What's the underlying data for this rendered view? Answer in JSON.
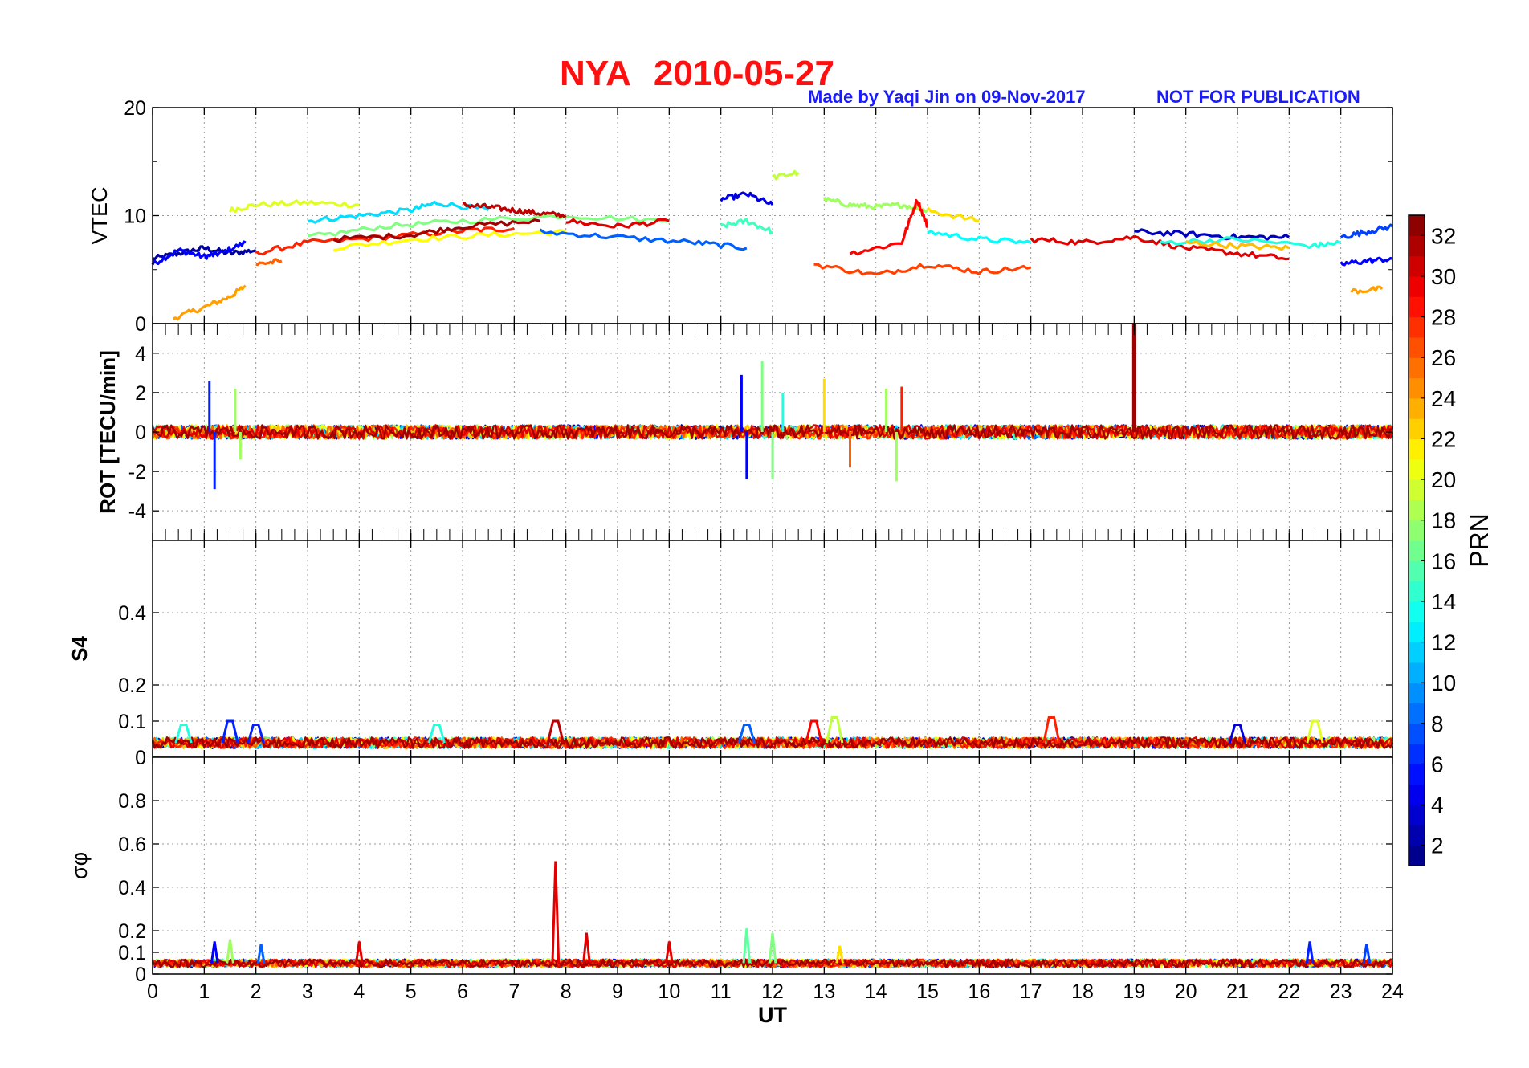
{
  "header": {
    "station": "NYA",
    "date": "2010-05-27",
    "credit": "Made by Yaqi Jin on 09-Nov-2017",
    "notice": "NOT FOR PUBLICATION"
  },
  "colors": {
    "title": "#ff1010",
    "credit": "#1a1aff",
    "grid": "#9a9a9a",
    "axis": "#000000"
  },
  "chart_data": [
    {
      "type": "line",
      "panel": "vtec",
      "ylabel": "VTEC",
      "ylim": [
        0,
        20
      ],
      "yticks": [
        0,
        10,
        20
      ],
      "xlim": [
        0,
        24
      ],
      "grid": true,
      "series": [
        {
          "prn": 2,
          "x": [
            0.0,
            0.5,
            1.0,
            1.5,
            2.0
          ],
          "y": [
            6.0,
            6.5,
            7.0,
            6.5,
            6.8
          ]
        },
        {
          "prn": 5,
          "x": [
            0.0,
            0.5,
            1.0,
            1.3,
            1.8
          ],
          "y": [
            5.5,
            6.8,
            6.2,
            6.5,
            7.5
          ]
        },
        {
          "prn": 24,
          "x": [
            0.4,
            1.0,
            1.5,
            1.8
          ],
          "y": [
            0.5,
            1.5,
            2.5,
            3.5
          ]
        },
        {
          "prn": 20,
          "x": [
            1.5,
            2.0,
            3.0,
            4.0
          ],
          "y": [
            10.5,
            11.0,
            11.2,
            11.0
          ]
        },
        {
          "prn": 26,
          "x": [
            2.0,
            2.5
          ],
          "y": [
            5.5,
            5.8
          ]
        },
        {
          "prn": 28,
          "x": [
            2.0,
            3.0,
            4.5,
            6.0,
            7.0
          ],
          "y": [
            6.5,
            7.5,
            8.0,
            8.6,
            8.8
          ]
        },
        {
          "prn": 12,
          "x": [
            3.0,
            4.0,
            5.0,
            5.5,
            6.5
          ],
          "y": [
            9.5,
            10.0,
            10.5,
            11.2,
            10.5
          ]
        },
        {
          "prn": 17,
          "x": [
            3.0,
            4.5,
            6.0,
            8.0,
            10.0
          ],
          "y": [
            8.0,
            9.0,
            9.5,
            10.0,
            9.5
          ]
        },
        {
          "prn": 21,
          "x": [
            3.5,
            5.0,
            6.5,
            8.0
          ],
          "y": [
            7.0,
            7.8,
            8.2,
            8.5
          ]
        },
        {
          "prn": 31,
          "x": [
            6.0,
            6.5,
            7.0,
            7.5,
            8.0
          ],
          "y": [
            11.0,
            10.8,
            10.5,
            10.2,
            10.0
          ]
        },
        {
          "prn": 32,
          "x": [
            3.5,
            5.0,
            6.0,
            7.5
          ],
          "y": [
            7.8,
            8.2,
            9.0,
            9.5
          ]
        },
        {
          "prn": 8,
          "x": [
            7.5,
            9.0,
            10.5,
            11.5
          ],
          "y": [
            8.5,
            8.0,
            7.5,
            7.0
          ]
        },
        {
          "prn": 30,
          "x": [
            8.0,
            9.0,
            10.0
          ],
          "y": [
            9.5,
            9.0,
            9.5
          ]
        },
        {
          "prn": 4,
          "x": [
            11.0,
            11.5,
            12.0
          ],
          "y": [
            11.5,
            12.0,
            11.0
          ]
        },
        {
          "prn": 15,
          "x": [
            11.0,
            11.5,
            12.0
          ],
          "y": [
            9.0,
            9.5,
            8.5
          ]
        },
        {
          "prn": 19,
          "x": [
            12.0,
            12.5
          ],
          "y": [
            13.5,
            14.0
          ]
        },
        {
          "prn": 18,
          "x": [
            13.0,
            13.5,
            14.0,
            14.5,
            15.0
          ],
          "y": [
            11.5,
            11.0,
            10.8,
            11.0,
            10.5
          ]
        },
        {
          "prn": 29,
          "x": [
            13.5,
            14.5,
            14.8,
            15.0
          ],
          "y": [
            6.5,
            7.5,
            11.5,
            9.0
          ]
        },
        {
          "prn": 27,
          "x": [
            12.8,
            14.0,
            15.0,
            16.0,
            17.0
          ],
          "y": [
            5.5,
            4.5,
            5.5,
            4.8,
            5.2
          ]
        },
        {
          "prn": 22,
          "x": [
            15.0,
            16.0
          ],
          "y": [
            10.5,
            9.5
          ]
        },
        {
          "prn": 13,
          "x": [
            15.0,
            16.0,
            17.0
          ],
          "y": [
            8.5,
            7.8,
            7.5
          ]
        },
        {
          "prn": 30,
          "x": [
            17.0,
            18.0,
            19.0,
            20.0,
            21.0,
            22.0
          ],
          "y": [
            7.8,
            7.5,
            8.0,
            7.0,
            6.5,
            6.0
          ]
        },
        {
          "prn": 3,
          "x": [
            19.0,
            20.0,
            21.0,
            22.0
          ],
          "y": [
            8.5,
            8.3,
            8.0,
            8.0
          ]
        },
        {
          "prn": 14,
          "x": [
            19.5,
            21.0,
            22.5,
            23.0
          ],
          "y": [
            7.5,
            7.8,
            7.2,
            7.5
          ]
        },
        {
          "prn": 23,
          "x": [
            20.0,
            21.0,
            22.0
          ],
          "y": [
            7.5,
            7.2,
            7.0
          ]
        },
        {
          "prn": 7,
          "x": [
            23.0,
            23.5,
            24.0
          ],
          "y": [
            8.0,
            8.5,
            9.0
          ]
        },
        {
          "prn": 24,
          "x": [
            23.2,
            23.8
          ],
          "y": [
            3.0,
            3.2
          ]
        },
        {
          "prn": 5,
          "x": [
            23.0,
            23.5,
            24.0
          ],
          "y": [
            5.5,
            5.8,
            6.0
          ]
        }
      ]
    },
    {
      "type": "line",
      "panel": "rot",
      "ylabel": "ROT [TECU/min]",
      "ylim": [
        -5.5,
        5.5
      ],
      "yticks": [
        -4,
        -2,
        0,
        2,
        4
      ],
      "xlim": [
        0,
        24
      ],
      "grid": true,
      "spikes": [
        {
          "x": 1.1,
          "y": 2.6,
          "prn": 6
        },
        {
          "x": 1.2,
          "y": -2.9,
          "prn": 6
        },
        {
          "x": 1.6,
          "y": 2.2,
          "prn": 18
        },
        {
          "x": 1.7,
          "y": -1.4,
          "prn": 18
        },
        {
          "x": 11.4,
          "y": 2.9,
          "prn": 5
        },
        {
          "x": 11.5,
          "y": -2.4,
          "prn": 5
        },
        {
          "x": 11.8,
          "y": 3.6,
          "prn": 17
        },
        {
          "x": 12.0,
          "y": -2.4,
          "prn": 17
        },
        {
          "x": 12.2,
          "y": 2.0,
          "prn": 14
        },
        {
          "x": 13.0,
          "y": 2.7,
          "prn": 22
        },
        {
          "x": 13.5,
          "y": -1.8,
          "prn": 26
        },
        {
          "x": 14.2,
          "y": 2.2,
          "prn": 18
        },
        {
          "x": 14.4,
          "y": -2.5,
          "prn": 18
        },
        {
          "x": 14.5,
          "y": 2.3,
          "prn": 28
        },
        {
          "x": 19.0,
          "y": 5.5,
          "prn": 32
        }
      ]
    },
    {
      "type": "line",
      "panel": "s4",
      "ylabel": "S4",
      "ylim": [
        0,
        0.6
      ],
      "yticks": [
        0,
        0.1,
        0.2,
        0.4
      ],
      "xlim": [
        0,
        24
      ],
      "grid": true,
      "peaks": [
        {
          "x": 0.6,
          "y": 0.09,
          "prn": 14
        },
        {
          "x": 1.5,
          "y": 0.1,
          "prn": 6
        },
        {
          "x": 2.0,
          "y": 0.09,
          "prn": 6
        },
        {
          "x": 5.5,
          "y": 0.09,
          "prn": 14
        },
        {
          "x": 7.8,
          "y": 0.1,
          "prn": 31
        },
        {
          "x": 11.5,
          "y": 0.09,
          "prn": 8
        },
        {
          "x": 12.8,
          "y": 0.1,
          "prn": 29
        },
        {
          "x": 13.2,
          "y": 0.11,
          "prn": 19
        },
        {
          "x": 17.4,
          "y": 0.11,
          "prn": 28
        },
        {
          "x": 21.0,
          "y": 0.09,
          "prn": 4
        },
        {
          "x": 22.5,
          "y": 0.1,
          "prn": 20
        }
      ]
    },
    {
      "type": "line",
      "panel": "sigma_phi",
      "ylabel": "σφ",
      "ylim": [
        0,
        1.0
      ],
      "yticks": [
        0,
        0.1,
        0.2,
        0.4,
        0.6,
        0.8
      ],
      "xlim": [
        0,
        24
      ],
      "xticks": [
        0,
        1,
        2,
        3,
        4,
        5,
        6,
        7,
        8,
        9,
        10,
        11,
        12,
        13,
        14,
        15,
        16,
        17,
        18,
        19,
        20,
        21,
        22,
        23,
        24
      ],
      "xlabel": "UT",
      "grid": true,
      "peaks": [
        {
          "x": 1.2,
          "y": 0.15,
          "prn": 5
        },
        {
          "x": 1.5,
          "y": 0.16,
          "prn": 18
        },
        {
          "x": 2.1,
          "y": 0.14,
          "prn": 8
        },
        {
          "x": 4.0,
          "y": 0.15,
          "prn": 30
        },
        {
          "x": 7.8,
          "y": 0.52,
          "prn": 30
        },
        {
          "x": 8.4,
          "y": 0.19,
          "prn": 30
        },
        {
          "x": 10.0,
          "y": 0.15,
          "prn": 30
        },
        {
          "x": 11.5,
          "y": 0.21,
          "prn": 16
        },
        {
          "x": 12.0,
          "y": 0.19,
          "prn": 17
        },
        {
          "x": 13.3,
          "y": 0.13,
          "prn": 22
        },
        {
          "x": 22.4,
          "y": 0.15,
          "prn": 6
        },
        {
          "x": 23.5,
          "y": 0.14,
          "prn": 7
        }
      ]
    }
  ],
  "colorbar": {
    "label": "PRN",
    "range": [
      1,
      33
    ],
    "ticks": [
      2,
      4,
      6,
      8,
      10,
      12,
      14,
      16,
      18,
      20,
      22,
      24,
      26,
      28,
      30,
      32
    ],
    "colormap": "jet"
  }
}
